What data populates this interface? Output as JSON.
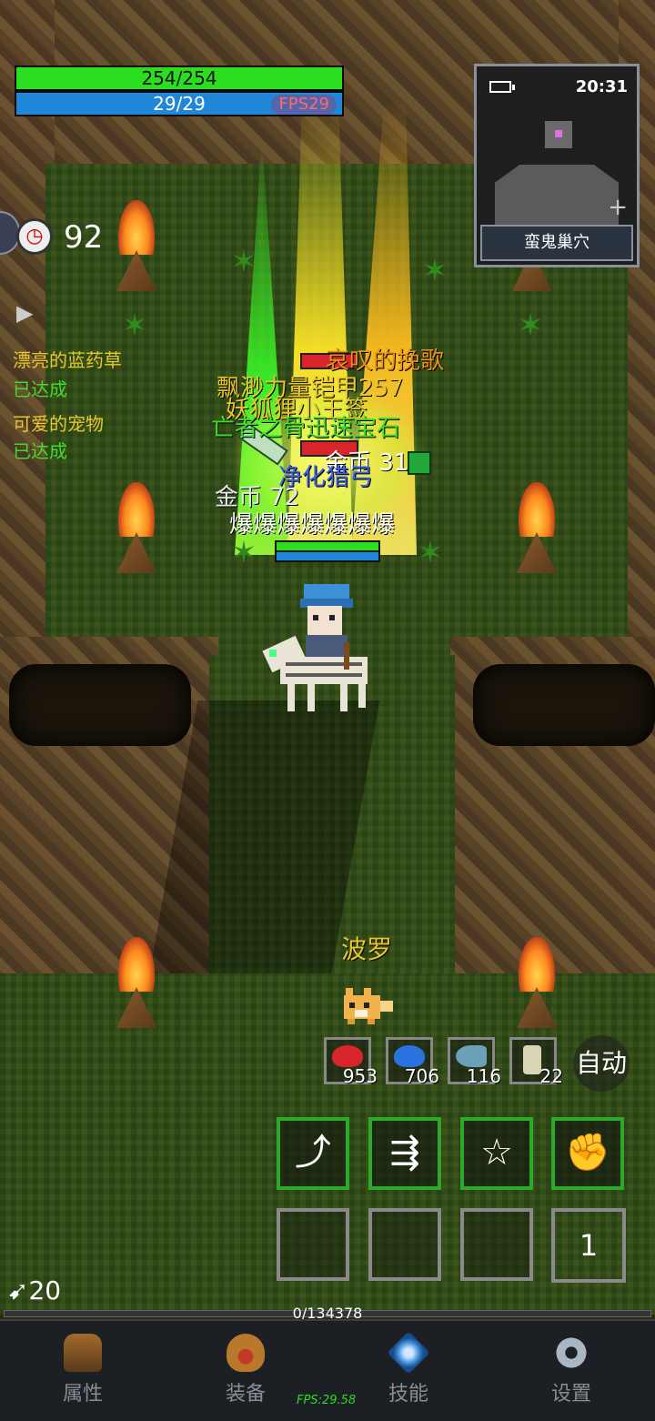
{
  "hud": {
    "hp": "254/254",
    "mp": "29/29",
    "fps_pill": "FPS29",
    "timer": "92"
  },
  "minimap": {
    "time": "20:31",
    "location": "蛮鬼巢穴"
  },
  "quests": [
    {
      "title": "漂亮的蓝药草",
      "status": "已达成"
    },
    {
      "title": "可爱的宠物",
      "status": "已达成"
    }
  ],
  "floating_texts": {
    "t1": "哀叹的挽歌",
    "t2": "飘渺力量铠甲257",
    "t3": "妖狐狸小王签",
    "t4": "亡者之骨迅速宝石",
    "t5": "金币 31",
    "t6": "净化猎弓",
    "t7": "金币 72",
    "t8": "爆爆爆爆爆爆爆"
  },
  "pet_name": "波罗",
  "potions": [
    {
      "name": "red-potion",
      "count": "953",
      "color": "#d8252b"
    },
    {
      "name": "blue-potion",
      "count": "706",
      "color": "#2a72e0"
    },
    {
      "name": "fish",
      "count": "116",
      "color": "#6aa0b8"
    },
    {
      "name": "scroll",
      "count": "22",
      "color": "#d9d6b8"
    }
  ],
  "auto_label": "自动",
  "skills": [
    "swing-skill-icon",
    "multi-arrow-skill-icon",
    "star-shot-skill-icon",
    "fist-skill-icon"
  ],
  "page_number": "1",
  "arrow_count": "20",
  "exp": "0/134378",
  "nav": {
    "attr": "属性",
    "equip": "装备",
    "skill": "技能",
    "settings": "设置"
  },
  "fps_bottom": "FPS:29.58"
}
